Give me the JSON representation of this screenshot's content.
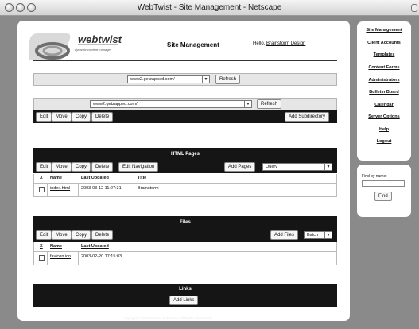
{
  "window": {
    "title": "WebTwist - Site Management - Netscape"
  },
  "header": {
    "logo_text": "webtwist",
    "logo_tagline": "dynamic content manager",
    "page_title": "Site Management",
    "hello_prefix": "Hello,",
    "user_name": "Brainstorm Design"
  },
  "site_selector": {
    "value": "www2.getzapped.com/",
    "refresh_label": "Refresh"
  },
  "dir_panel": {
    "path_value": "www2.getzapped.com/",
    "refresh_label": "Refresh",
    "buttons": {
      "edit": "Edit",
      "move": "Move",
      "copy": "Copy",
      "delete": "Delete"
    },
    "add_subdirectory": "Add Subdirectory"
  },
  "html_pages": {
    "title": "HTML Pages",
    "buttons": {
      "edit": "Edit",
      "move": "Move",
      "copy": "Copy",
      "delete": "Delete",
      "edit_navigation": "Edit Navigation"
    },
    "add_pages": "Add Pages",
    "mode_select": "Query",
    "columns": {
      "x": "X",
      "name": "Name",
      "last_updated": "Last Updated",
      "title": "Title"
    },
    "rows": [
      {
        "name": "index.html",
        "last_updated": "2003-03-12 11:27:31",
        "title": "Brainstorm"
      }
    ]
  },
  "files": {
    "title": "Files",
    "buttons": {
      "edit": "Edit",
      "move": "Move",
      "copy": "Copy",
      "delete": "Delete"
    },
    "add_files": "Add Files",
    "mode_select": "Batch",
    "columns": {
      "x": "X",
      "name": "Name",
      "last_updated": "Last Updated"
    },
    "rows": [
      {
        "name": "favicon.ico",
        "last_updated": "2003-02-20 17:15:03"
      }
    ]
  },
  "links": {
    "title": "Links",
    "add_links": "Add Links"
  },
  "footer": {
    "copyright": "Copyright © 2001 Bottled Software - All Rights Reserved"
  },
  "sidebar": {
    "items": [
      {
        "label": "Site Management"
      },
      {
        "label": "Client Accounts"
      },
      {
        "label": "Templates"
      },
      {
        "label": "Content Forms"
      },
      {
        "label": "Administrators"
      },
      {
        "label": "Bulletin Board"
      },
      {
        "label": "Calendar"
      },
      {
        "label": "Server Options"
      },
      {
        "label": "Help"
      },
      {
        "label": "Logout"
      }
    ]
  },
  "find": {
    "label": "Find by name:",
    "button": "Find"
  }
}
